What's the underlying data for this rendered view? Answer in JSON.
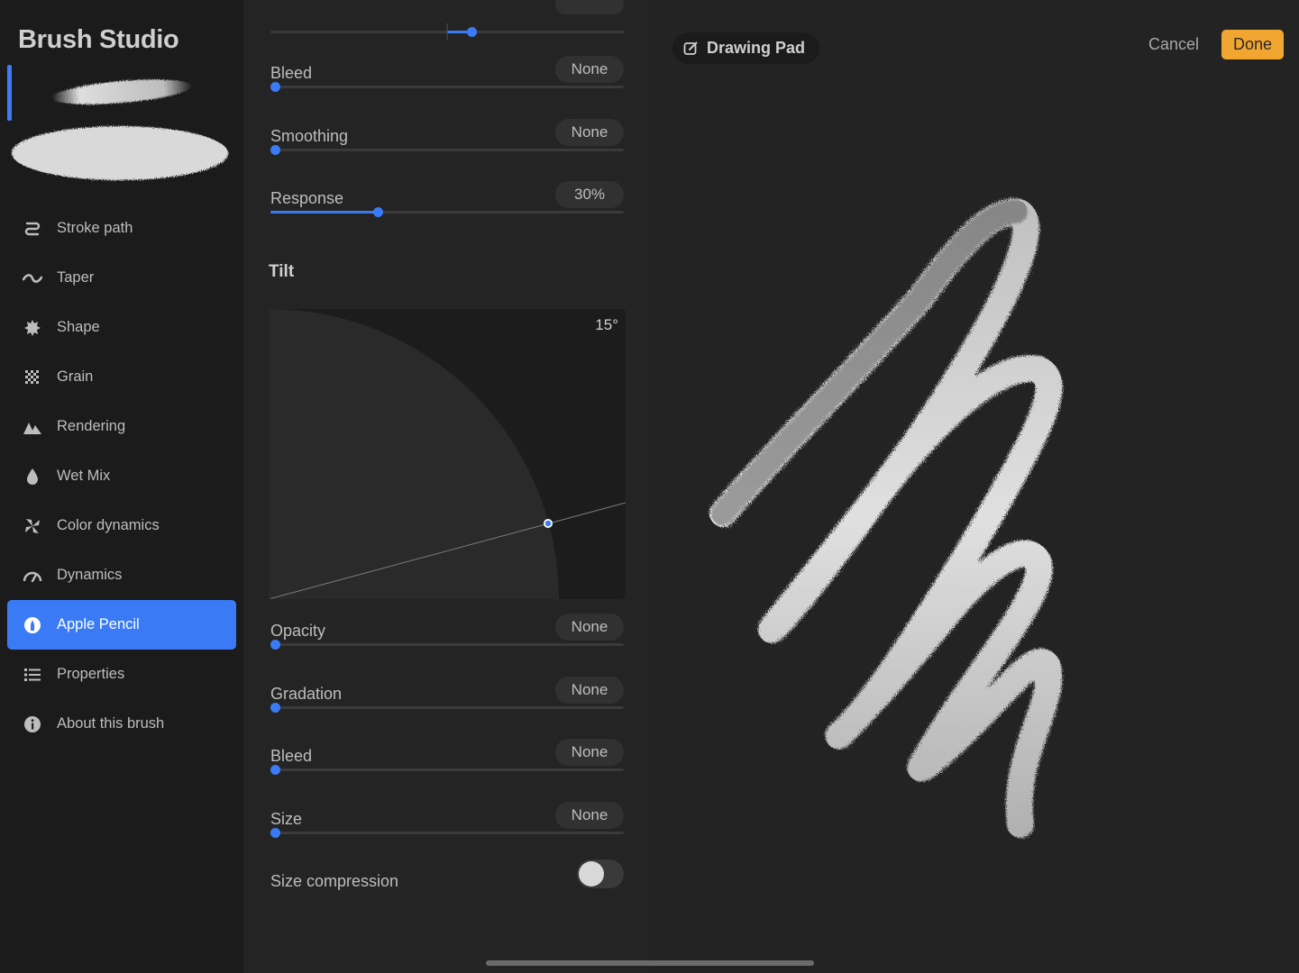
{
  "app": {
    "title": "Brush Studio"
  },
  "sidebar": {
    "items": [
      {
        "label": "Stroke path",
        "icon": "stroke-path-icon",
        "active": false
      },
      {
        "label": "Taper",
        "icon": "taper-icon",
        "active": false
      },
      {
        "label": "Shape",
        "icon": "shape-icon",
        "active": false
      },
      {
        "label": "Grain",
        "icon": "grain-icon",
        "active": false
      },
      {
        "label": "Rendering",
        "icon": "rendering-icon",
        "active": false
      },
      {
        "label": "Wet Mix",
        "icon": "wet-mix-icon",
        "active": false
      },
      {
        "label": "Color dynamics",
        "icon": "color-dynamics-icon",
        "active": false
      },
      {
        "label": "Dynamics",
        "icon": "dynamics-icon",
        "active": false
      },
      {
        "label": "Apple Pencil",
        "icon": "apple-pencil-icon",
        "active": true
      },
      {
        "label": "Properties",
        "icon": "properties-icon",
        "active": false
      },
      {
        "label": "About this brush",
        "icon": "info-icon",
        "active": false
      }
    ]
  },
  "pressure": {
    "flow": {
      "value_fraction": 0.57
    },
    "bleed": {
      "label": "Bleed",
      "value": "None",
      "value_fraction": 0.0
    },
    "smoothing": {
      "label": "Smoothing",
      "value": "None",
      "value_fraction": 0.0
    },
    "response": {
      "label": "Response",
      "value": "30%",
      "value_fraction": 0.3
    }
  },
  "tilt": {
    "title": "Tilt",
    "angle": "15°",
    "opacity": {
      "label": "Opacity",
      "value": "None",
      "value_fraction": 0.0
    },
    "gradation": {
      "label": "Gradation",
      "value": "None",
      "value_fraction": 0.0
    },
    "bleed": {
      "label": "Bleed",
      "value": "None",
      "value_fraction": 0.0
    },
    "size": {
      "label": "Size",
      "value": "None",
      "value_fraction": 0.0
    },
    "size_compression": {
      "label": "Size compression",
      "on": false
    }
  },
  "pad": {
    "title": "Drawing Pad",
    "cancel": "Cancel",
    "done": "Done"
  },
  "colors": {
    "accent": "#3a7bf5",
    "done": "#f2a632"
  }
}
